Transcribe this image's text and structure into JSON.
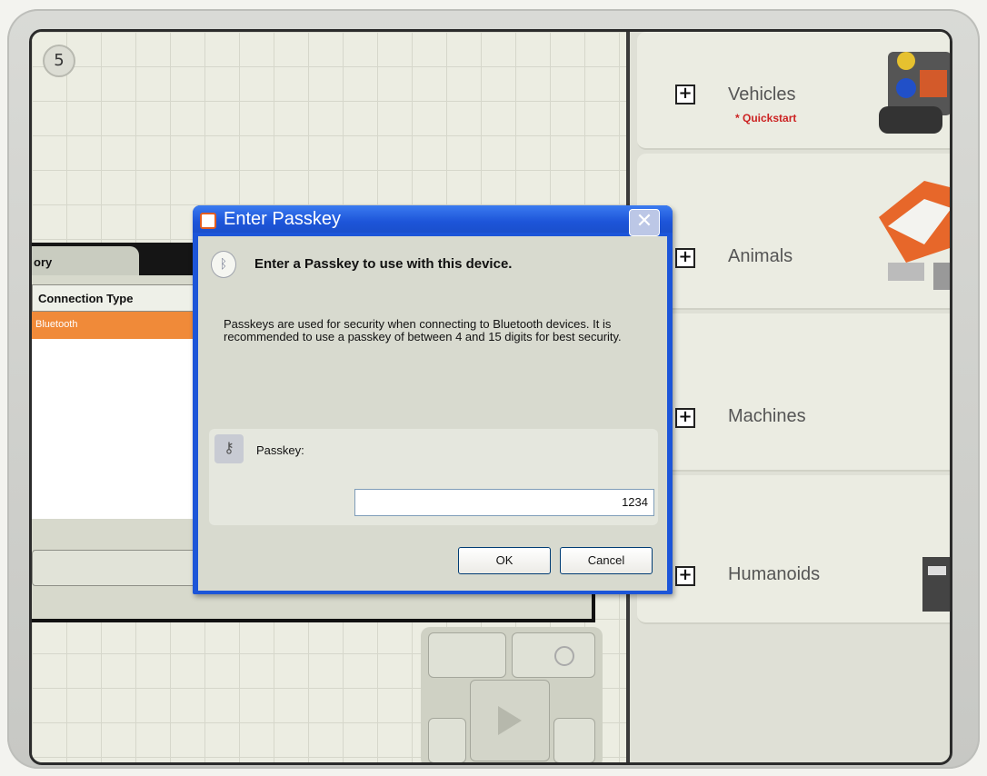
{
  "canvas": {
    "step_number": "5"
  },
  "categories": [
    {
      "label": "Vehicles",
      "sub": "* Quickstart"
    },
    {
      "label": "Animals",
      "sub": ""
    },
    {
      "label": "Machines",
      "sub": ""
    },
    {
      "label": "Humanoids",
      "sub": ""
    }
  ],
  "background_dialog": {
    "tab_label": "ory",
    "column_header": "Connection Type",
    "selected_row": "Bluetooth"
  },
  "passkey_dialog": {
    "title": "Enter Passkey",
    "close_glyph": "✕",
    "heading": "Enter a Passkey to use with this device.",
    "description": "Passkeys are used for security when connecting to Bluetooth devices. It is recommended to use a passkey of between 4 and 15 digits for best security.",
    "passkey_label": "Passkey:",
    "passkey_value": "1234",
    "ok_label": "OK",
    "cancel_label": "Cancel"
  },
  "colors": {
    "accent_orange": "#f08a39",
    "xp_blue": "#1c55d8",
    "quickstart_red": "#cc2222"
  },
  "icons": [
    "bluetooth-icon",
    "key-icon",
    "app-icon",
    "close-icon",
    "plus-icon",
    "play-icon"
  ]
}
